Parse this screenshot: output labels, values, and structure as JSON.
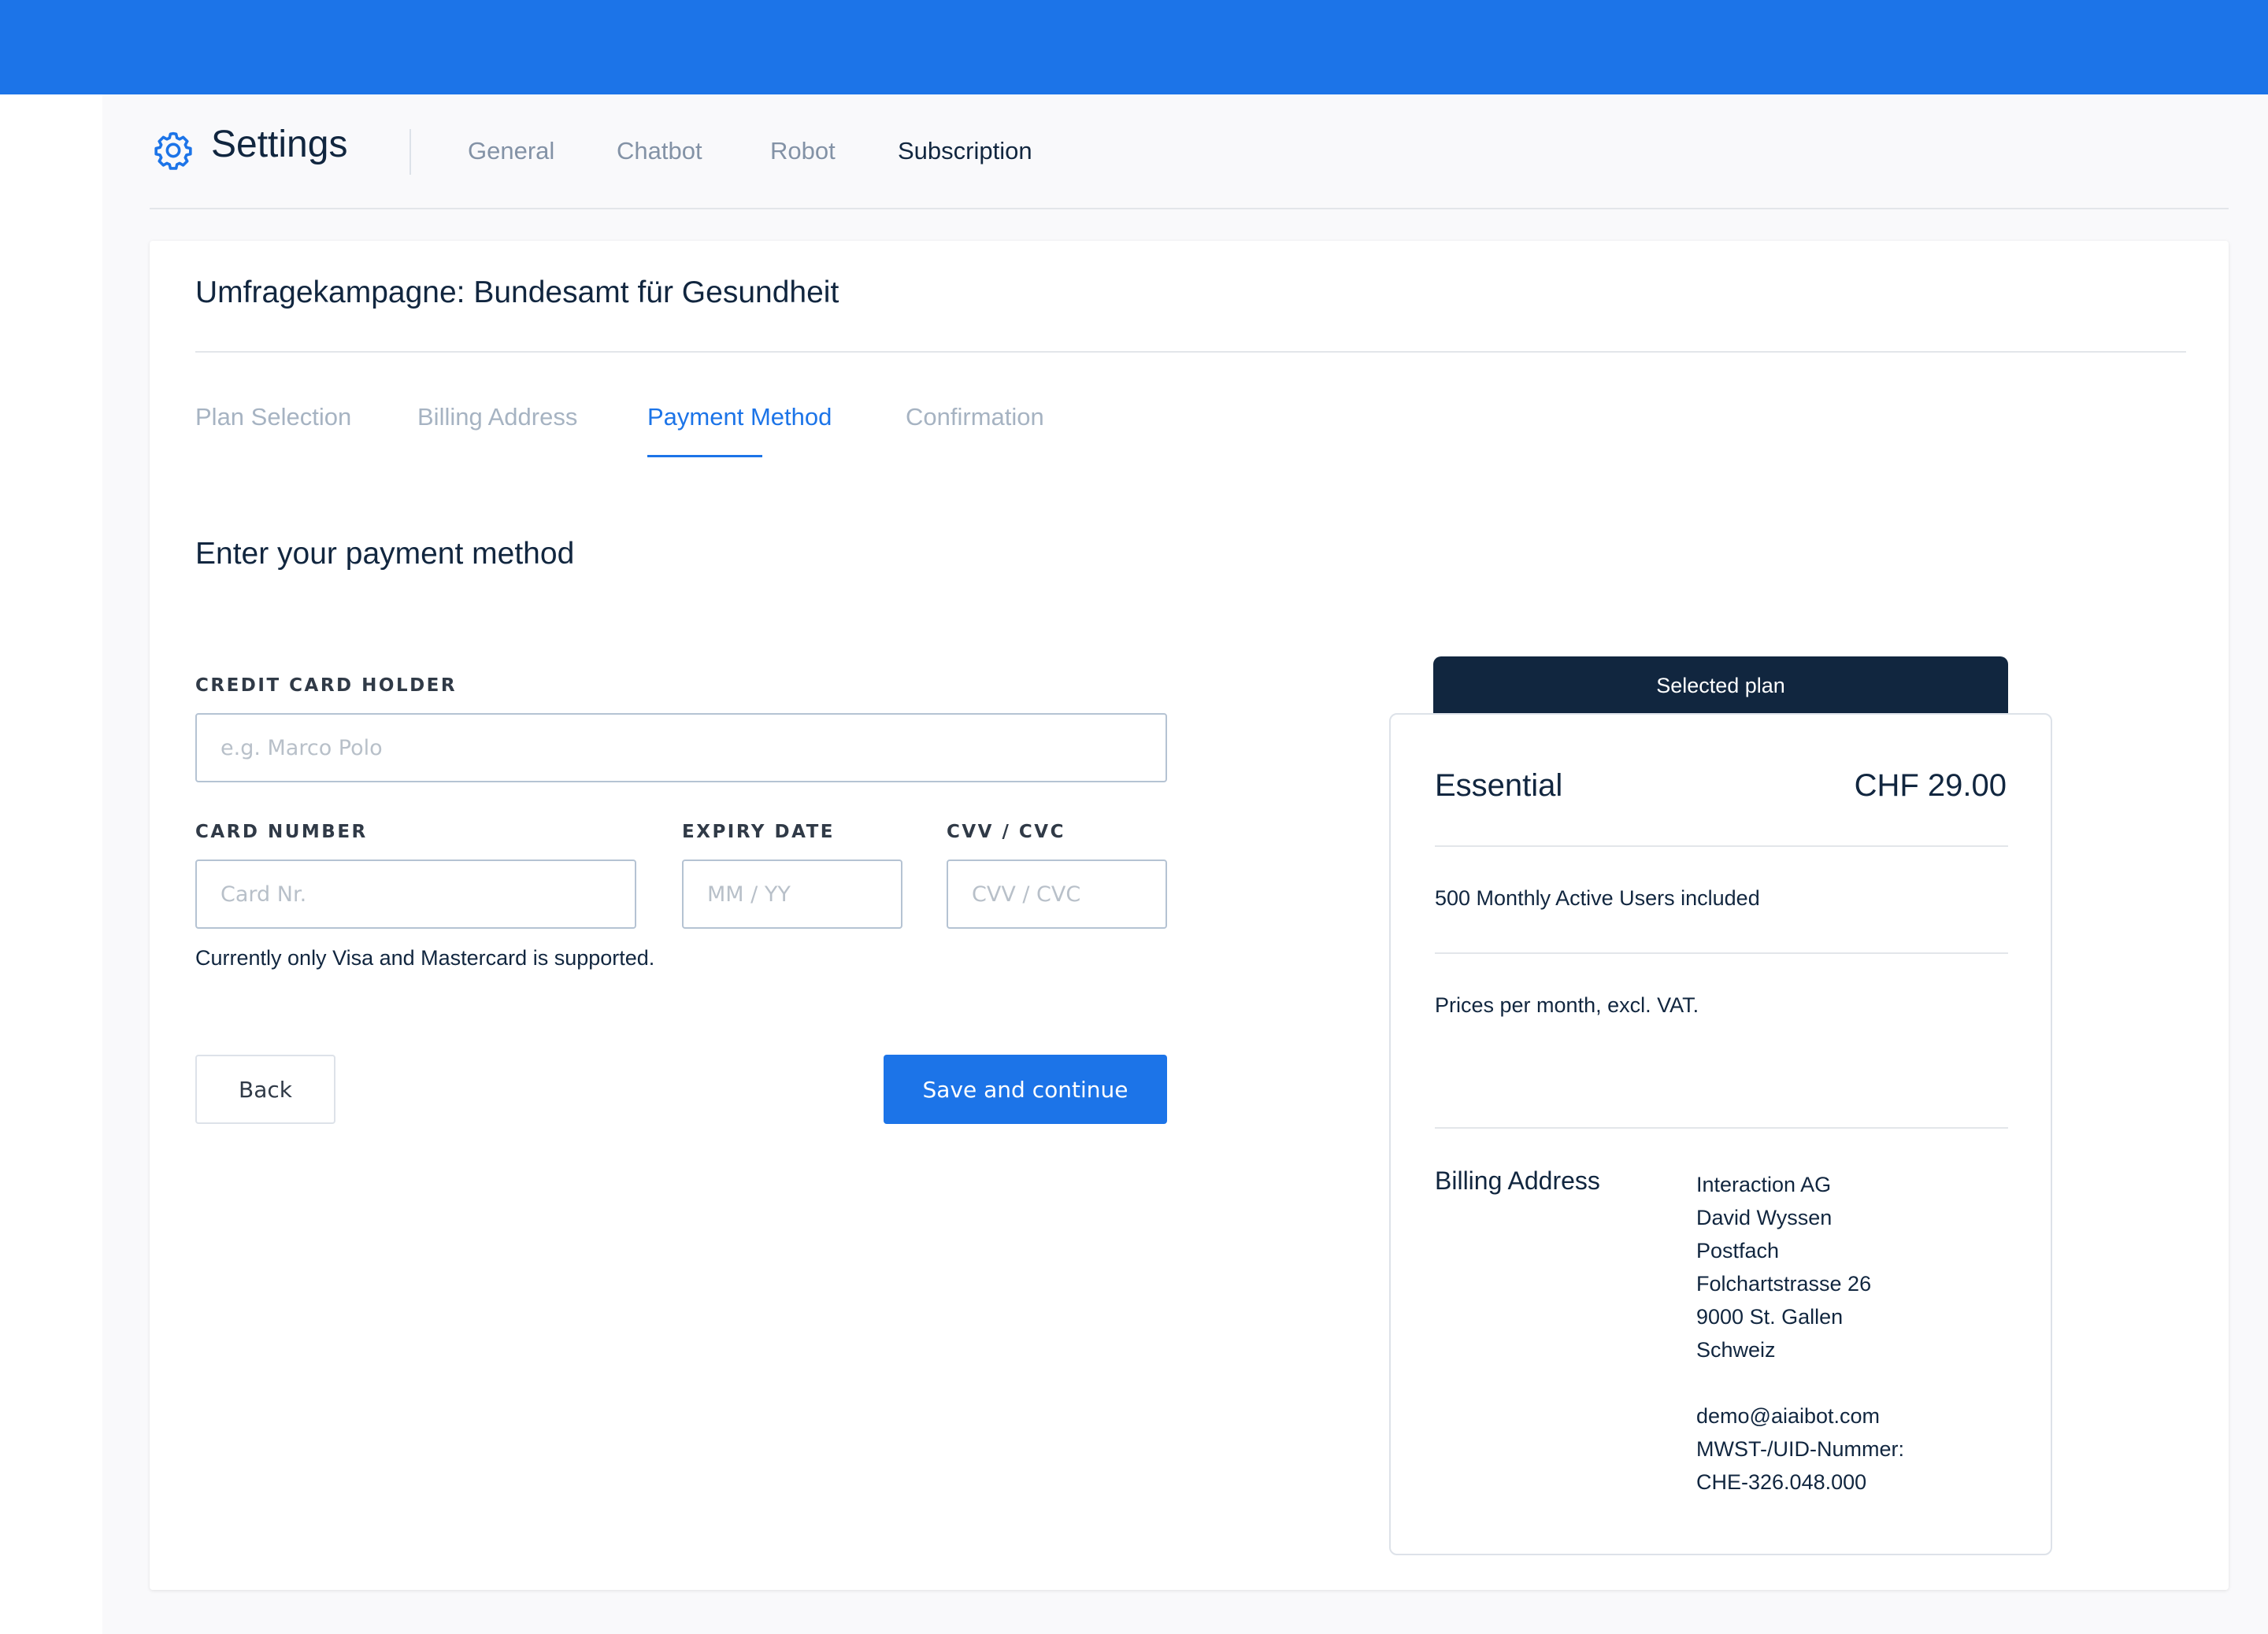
{
  "header": {
    "title": "Settings",
    "icon": "gear-icon",
    "tabs": [
      {
        "label": "General",
        "active": false
      },
      {
        "label": "Chatbot",
        "active": false
      },
      {
        "label": "Robot",
        "active": false
      },
      {
        "label": "Subscription",
        "active": true
      }
    ]
  },
  "card": {
    "title": "Umfragekampagne: Bundesamt für Gesundheit",
    "steps": [
      {
        "label": "Plan Selection",
        "active": false
      },
      {
        "label": "Billing Address",
        "active": false
      },
      {
        "label": "Payment Method",
        "active": true
      },
      {
        "label": "Confirmation",
        "active": false
      }
    ]
  },
  "payment": {
    "section_title": "Enter your payment method",
    "holder_label": "CREDIT CARD HOLDER",
    "holder_placeholder": "e.g. Marco Polo",
    "number_label": "CARD NUMBER",
    "number_placeholder": "Card Nr.",
    "expiry_label": "EXPIRY DATE",
    "expiry_placeholder": "MM / YY",
    "cvv_label": "CVV / CVC",
    "cvv_placeholder": "CVV / CVC",
    "note": "Currently only Visa and Mastercard is supported.",
    "back_label": "Back",
    "save_label": "Save and continue"
  },
  "plan": {
    "header": "Selected plan",
    "name": "Essential",
    "price": "CHF 29.00",
    "users": "500 Monthly Active Users included",
    "prices_note": "Prices per month, excl. VAT.",
    "billing_label": "Billing Address",
    "billing_lines": [
      "Interaction AG",
      "David Wyssen",
      "Postfach",
      "Folchartstrasse 26",
      "9000 St. Gallen",
      "Schweiz",
      "",
      "demo@aiaibot.com",
      "MWST-/UID-Nummer:",
      "CHE-326.048.000"
    ]
  },
  "colors": {
    "brand_blue": "#1c74e8",
    "navy": "#11263f",
    "muted_tab": "#8392a6",
    "inactive_step": "#a6b3c2"
  }
}
